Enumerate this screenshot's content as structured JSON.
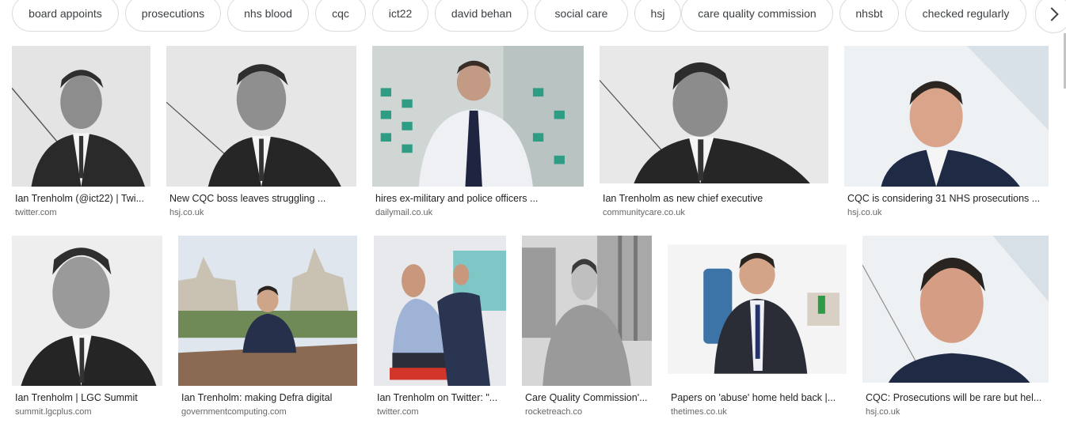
{
  "chips": [
    {
      "label": "board appoints"
    },
    {
      "label": "prosecutions"
    },
    {
      "label": "nhs blood"
    },
    {
      "label": "cqc"
    },
    {
      "label": "ict22"
    },
    {
      "label": "david behan"
    },
    {
      "label": "social care"
    },
    {
      "label": "hsj"
    },
    {
      "label": "care quality commission"
    },
    {
      "label": "nhsbt"
    },
    {
      "label": "checked regularly"
    }
  ],
  "next_icon": "chevron-right-icon",
  "results": [
    {
      "caption": "Ian Trenholm (@ict22) | Twi...",
      "source": "twitter.com"
    },
    {
      "caption": "New CQC boss leaves struggling ...",
      "source": "hsj.co.uk"
    },
    {
      "caption": "hires ex-military and police officers ...",
      "source": "dailymail.co.uk"
    },
    {
      "caption": "Ian Trenholm as new chief executive",
      "source": "communitycare.co.uk"
    },
    {
      "caption": "CQC is considering 31 NHS prosecutions ...",
      "source": "hsj.co.uk"
    },
    {
      "caption": "Ian Trenholm | LGC Summit",
      "source": "summit.lgcplus.com"
    },
    {
      "caption": "Ian Trenholm: making Defra digital",
      "source": "governmentcomputing.com"
    },
    {
      "caption": "Ian Trenholm on Twitter: \"...",
      "source": "twitter.com"
    },
    {
      "caption": "Care Quality Commission'...",
      "source": "rocketreach.co"
    },
    {
      "caption": "Papers on 'abuse' home held back |...",
      "source": "thetimes.co.uk"
    },
    {
      "caption": "CQC: Prosecutions will be rare but hel...",
      "source": "hsj.co.uk"
    }
  ],
  "colors": {
    "chip_border": "#dadce0",
    "chip_text": "#3c4043",
    "caption_text": "#222222",
    "source_text": "#666666"
  }
}
